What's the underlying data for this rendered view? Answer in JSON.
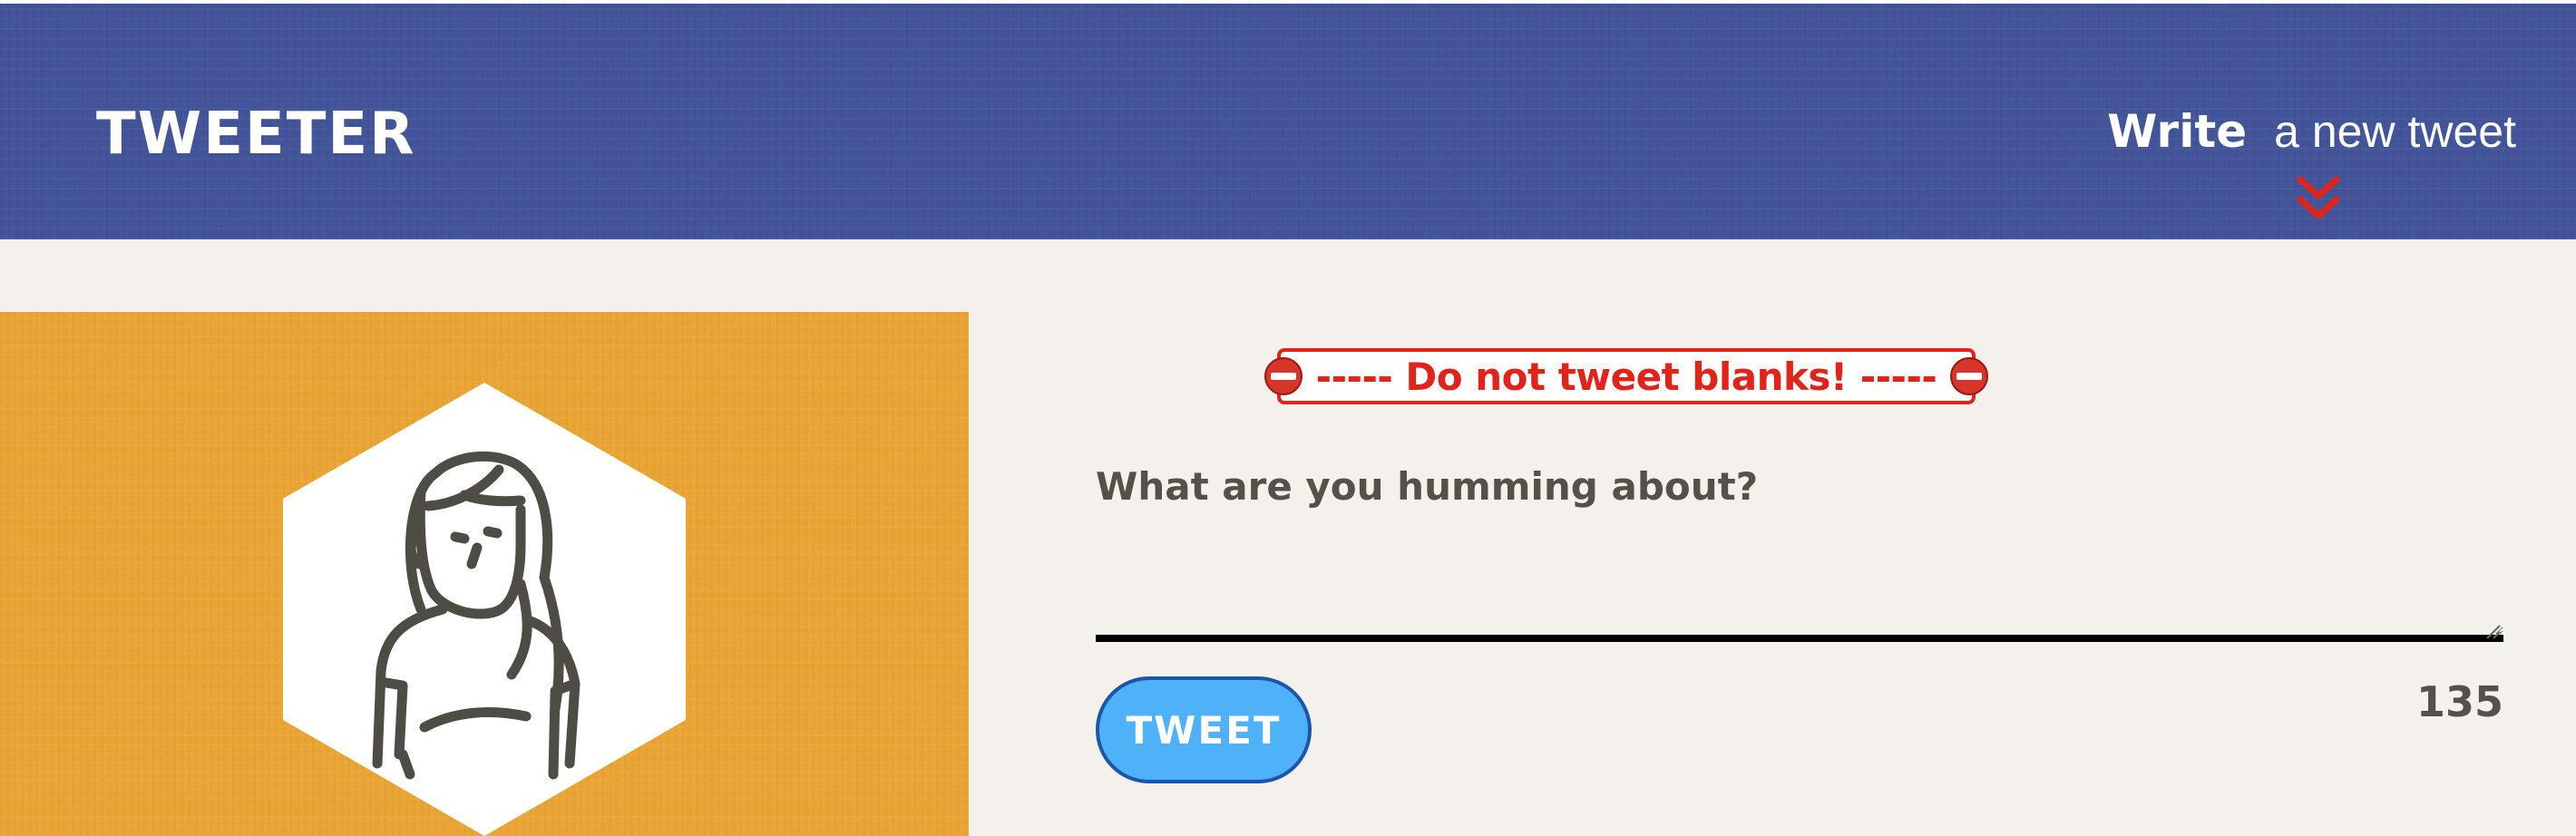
{
  "header": {
    "brand": "Tweeter",
    "compose_nav": {
      "bold_label": "Write",
      "light_label": "a new tweet"
    },
    "scroll_icon": "double-chevron-down-icon"
  },
  "profile": {
    "avatar_icon": "user-avatar-icon"
  },
  "compose": {
    "error_message": "----- Do not tweet blanks! -----",
    "error_icon": "no-entry-icon",
    "label": "What are you humming about?",
    "textarea_value": "",
    "submit_label": "Tweet",
    "char_counter": "135"
  },
  "colors": {
    "header_bg": "#43559a",
    "page_bg": "#f4f1ec",
    "profile_bg": "#eaa635",
    "error_red": "#e2231a",
    "button_blue": "#4fb1f7",
    "button_border": "#1b56a8",
    "text_gray": "#545149"
  }
}
